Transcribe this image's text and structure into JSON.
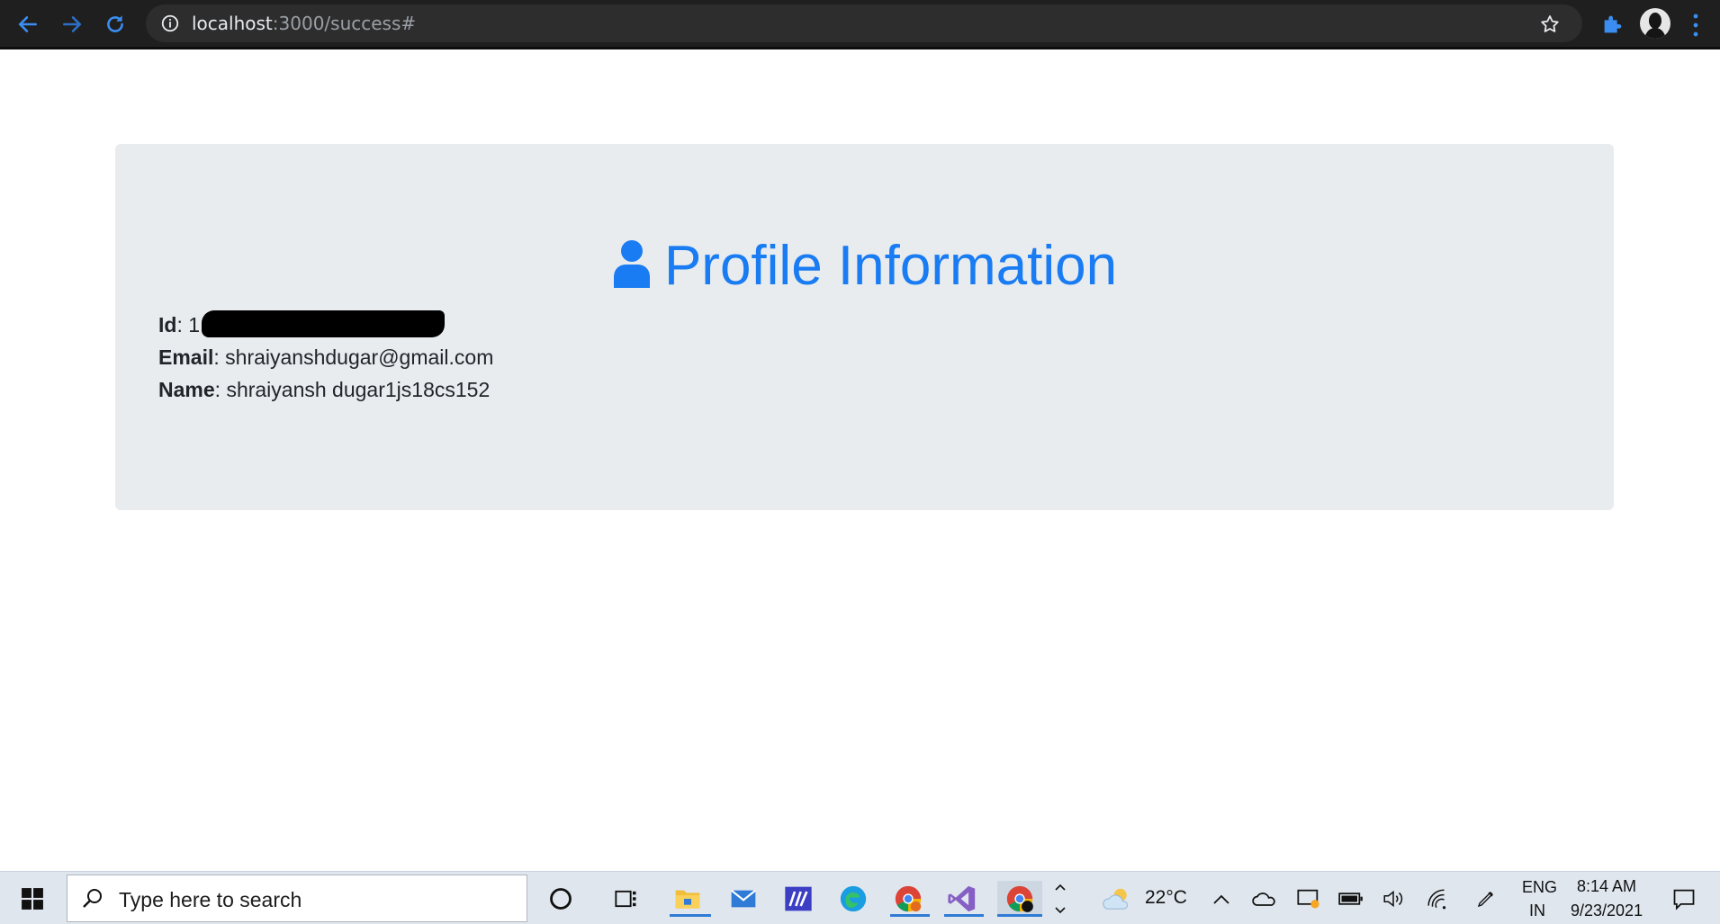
{
  "browser": {
    "url_host": "localhost",
    "url_rest": ":3000/success#",
    "icons": {
      "back": "back-arrow-icon",
      "forward": "forward-arrow-icon",
      "reload": "reload-icon",
      "site_info": "info-icon",
      "bookmark": "star-icon",
      "extensions": "puzzle-icon",
      "profile": "avatar",
      "menu": "kebab-menu-icon"
    }
  },
  "page": {
    "title": "Profile Information",
    "fields": {
      "id_label": "Id",
      "id_value_visible": "1",
      "email_label": "Email",
      "email_value": "shraiyanshdugar@gmail.com",
      "name_label": "Name",
      "name_value": "shraiyansh dugar1js18cs152"
    },
    "colors": {
      "title": "#1a7cf2",
      "jumbotron_bg": "#e9ecef"
    }
  },
  "taskbar": {
    "search_placeholder": "Type here to search",
    "weather_temp": "22°C",
    "language_top": "ENG",
    "language_bottom": "IN",
    "time": "8:14 AM",
    "date": "9/23/2021"
  }
}
